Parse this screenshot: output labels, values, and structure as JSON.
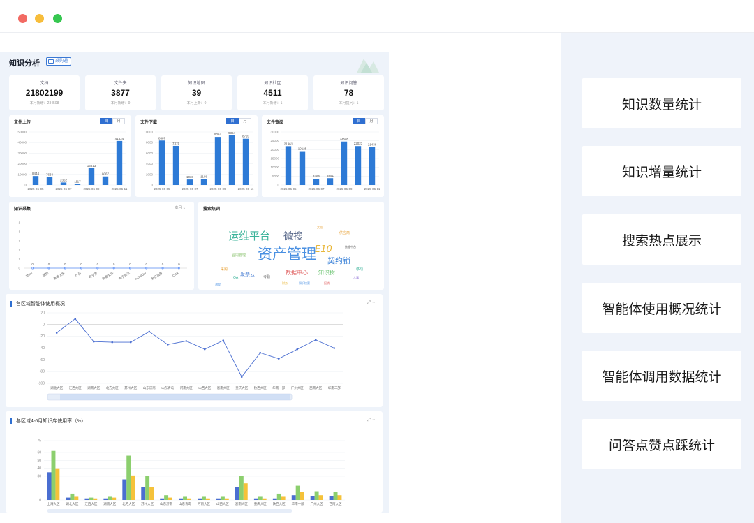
{
  "dashboard": {
    "title": "知识分析",
    "badge": "采购通",
    "stats": [
      {
        "label": "文档",
        "value": "21802199",
        "sub": "本月新增：234508"
      },
      {
        "label": "文件夹",
        "value": "3877",
        "sub": "本月新增：9"
      },
      {
        "label": "知识地图",
        "value": "39",
        "sub": "本月上新：0"
      },
      {
        "label": "知识社区",
        "value": "4511",
        "sub": "本月新增：1"
      },
      {
        "label": "知识问答",
        "value": "78",
        "sub": "本月提问：1"
      }
    ],
    "toggle": [
      "日",
      "月"
    ],
    "upload": {
      "title": "文件上传"
    },
    "download": {
      "title": "文件下载"
    },
    "query": {
      "title": "文件查阅"
    },
    "collect": {
      "title": "知识采集",
      "dropdown": "本月"
    },
    "hot": {
      "title": "搜索热词"
    },
    "agent": {
      "title": "各区域智能体使用概况"
    },
    "kb": {
      "title": "各区域4-6月知识库使用率（%）"
    },
    "wordcloud": [
      {
        "text": "运维平台",
        "color": "#3bb39a"
      },
      {
        "text": "微搜",
        "color": "#5b6b8c"
      },
      {
        "text": "E10",
        "color": "#e8b73a"
      },
      {
        "text": "资产管理",
        "color": "#4a90e2"
      },
      {
        "text": "契约锁",
        "color": "#3b82d8"
      },
      {
        "text": "数据中心",
        "color": "#e06060"
      },
      {
        "text": "知识树",
        "color": "#68c26e"
      },
      {
        "text": "发票云",
        "color": "#4a7fd4"
      },
      {
        "text": "合同管理",
        "color": "#8ac26e"
      },
      {
        "text": "供应商",
        "color": "#e8a33a"
      },
      {
        "text": "数据中台",
        "color": "#555"
      },
      {
        "text": "考勤",
        "color": "#666"
      },
      {
        "text": "采购",
        "color": "#e8a33a"
      },
      {
        "text": "OA",
        "color": "#3bb39a"
      },
      {
        "text": "人事",
        "color": "#8c6fd4"
      },
      {
        "text": "财务",
        "color": "#e8b73a"
      },
      {
        "text": "知识检索",
        "color": "#4a90e2"
      },
      {
        "text": "报销",
        "color": "#e06060"
      },
      {
        "text": "流程",
        "color": "#4a90e2"
      },
      {
        "text": "移动",
        "color": "#3bb39a"
      },
      {
        "text": "文档",
        "color": "#e8a33a"
      }
    ]
  },
  "features": [
    "知识数量统计",
    "知识增量统计",
    "搜索热点展示",
    "智能体使用概况统计",
    "智能体调用数据统计",
    "问答点赞点踩统计"
  ],
  "chart_data": [
    {
      "type": "bar",
      "title": "文件上传",
      "categories": [
        "2025-06-05",
        "2025-06-06",
        "2025-06-07",
        "2025-06-08",
        "2025-06-09",
        "2025-06-10",
        "2025-06-11"
      ],
      "xticks": [
        "2025-06-05",
        "2025-06-07",
        "2025-06-09",
        "2025-06-11"
      ],
      "values": [
        8444,
        7634,
        2362,
        1117,
        15813,
        8067,
        41524
      ],
      "ylim": [
        0,
        50000
      ],
      "yticks": [
        0,
        10000,
        20000,
        30000,
        40000,
        50000
      ],
      "color": "#2d7ad6"
    },
    {
      "type": "bar",
      "title": "文件下载",
      "categories": [
        "2025-06-05",
        "2025-06-06",
        "2025-06-07",
        "2025-06-08",
        "2025-06-09",
        "2025-06-10",
        "2025-06-11"
      ],
      "xticks": [
        "2025-06-05",
        "2025-06-07",
        "2025-06-09",
        "2025-06-11"
      ],
      "values": [
        8387,
        7375,
        1038,
        1108,
        9064,
        9364,
        8720
      ],
      "ylim": [
        0,
        10000
      ],
      "yticks": [
        0,
        2000,
        4000,
        6000,
        8000,
        10000
      ],
      "color": "#2d7ad6"
    },
    {
      "type": "bar",
      "title": "文件查阅",
      "categories": [
        "2025-06-05",
        "2025-06-06",
        "2025-06-07",
        "2025-06-08",
        "2025-06-09",
        "2025-06-10",
        "2025-06-11"
      ],
      "xticks": [
        "2025-06-05",
        "2025-06-07",
        "2025-06-09",
        "2025-06-11"
      ],
      "values": [
        21961,
        19125,
        3466,
        3851,
        24585,
        22023,
        21436
      ],
      "ylim": [
        0,
        30000
      ],
      "yticks": [
        0,
        5000,
        10000,
        15000,
        20000,
        25000,
        30000
      ],
      "color": "#2d7ad6"
    },
    {
      "type": "line",
      "title": "知识采集",
      "categories": [
        "Jitom",
        "通知",
        "表单上报",
        "产品",
        "电子签",
        "档案文件",
        "电子资讯",
        "e-Builder",
        "报价品量",
        "CRX"
      ],
      "values": [
        0,
        0,
        0,
        0,
        0,
        0,
        0,
        0,
        0,
        0
      ],
      "ylim": [
        0,
        1
      ],
      "yticks": [
        "0",
        "1",
        "1",
        "1",
        "1",
        "1"
      ],
      "color": "#5b8ff9"
    },
    {
      "type": "line",
      "title": "各区域智能体使用概况",
      "categories": [
        "湖北大区",
        "江西大区",
        "湖南大区",
        "北方大区",
        "苏州大区",
        "山东济南",
        "山东青岛",
        "河南大区",
        "山西大区",
        "浙南大区",
        "重庆大区",
        "陕西大区",
        "华南一部",
        "广州大区",
        "西南大区",
        "华南二部"
      ],
      "values": [
        -14,
        10,
        -29,
        -30,
        -30,
        -12,
        -34,
        -28,
        -42,
        -27,
        -89,
        -48,
        -58,
        -42,
        -26,
        -40
      ],
      "ylim": [
        -100,
        20
      ],
      "yticks": [
        20,
        0,
        -20,
        -40,
        -60,
        -80,
        -100
      ],
      "color": "#4a6ed1"
    },
    {
      "type": "bar",
      "title": "各区域4-6月知识库使用率（%）",
      "categories": [
        "上海大区",
        "湖北大区",
        "江西大区",
        "湖南大区",
        "北方大区",
        "苏州大区",
        "山东济南",
        "山东青岛",
        "河南大区",
        "山西大区",
        "浙南大区",
        "重庆大区",
        "陕西大区",
        "华南一部",
        "广州大区",
        "西南大区"
      ],
      "series": [
        {
          "name": "4月",
          "values": [
            35,
            3,
            2,
            2,
            26,
            16,
            2,
            2,
            2,
            2,
            16,
            2,
            2,
            6,
            5,
            5
          ],
          "color": "#4a6ed1"
        },
        {
          "name": "5月",
          "values": [
            62,
            8,
            3,
            4,
            56,
            30,
            6,
            4,
            4,
            4,
            30,
            4,
            8,
            18,
            11,
            10
          ],
          "color": "#8ccf6e"
        },
        {
          "name": "6月",
          "values": [
            40,
            4,
            2,
            3,
            31,
            16,
            3,
            2,
            2,
            2,
            21,
            2,
            4,
            10,
            6,
            6
          ],
          "color": "#f5c23a"
        }
      ],
      "ylim": [
        0,
        75
      ],
      "yticks": [
        0,
        30,
        40,
        50,
        60,
        75
      ]
    }
  ]
}
